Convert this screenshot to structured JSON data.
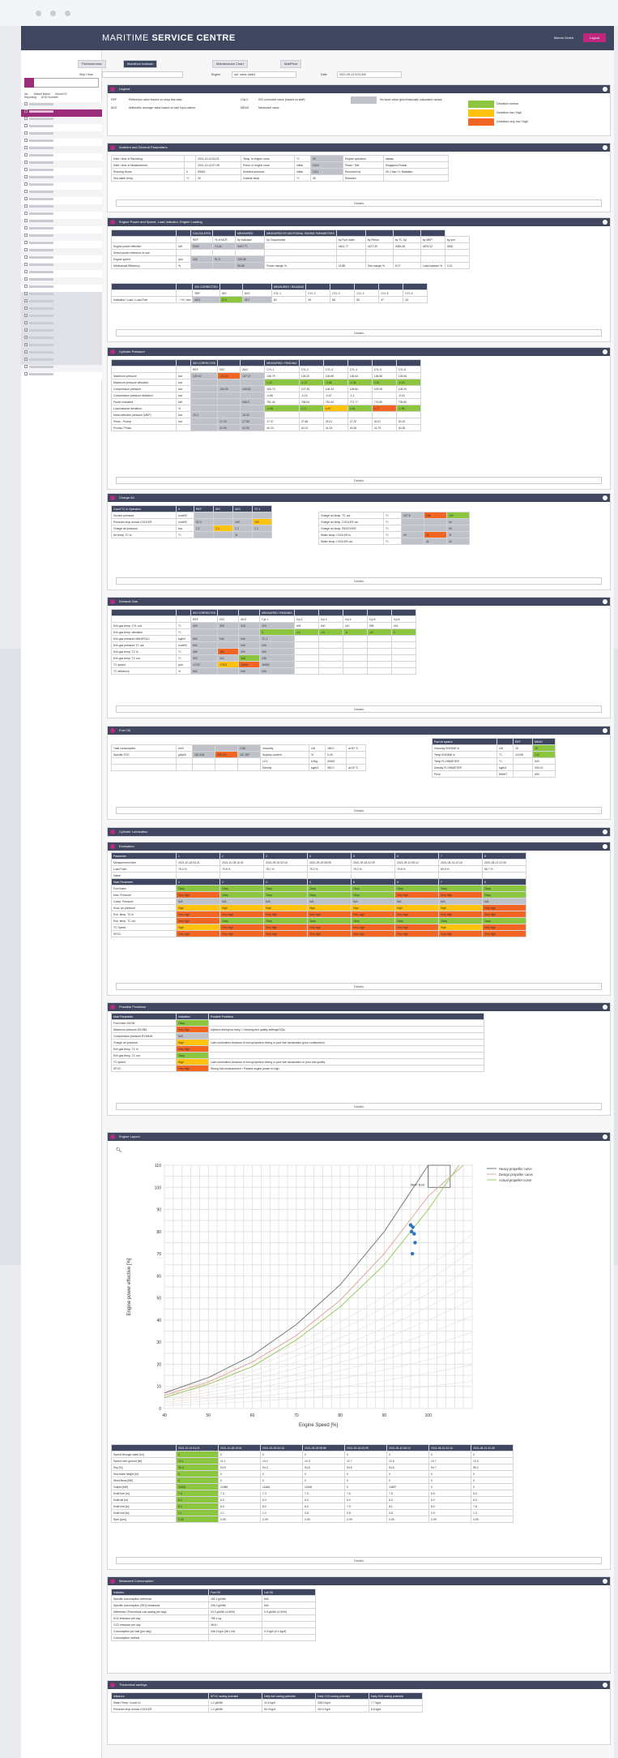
{
  "app": {
    "brand_light": "MARITIME ",
    "brand_bold": "SERVICE CENTRE",
    "user": "Marvin Gmbh",
    "logout": "Logout"
  },
  "sidebar": {
    "header": [
      "No.",
      "Vessel Name",
      "Vessel ID",
      "Reporting",
      "AHD Number"
    ],
    "item_count": 38
  },
  "tabs": [
    {
      "label": "Fleetoverview",
      "active": false
    },
    {
      "label": "Maruthon Inabuan",
      "active": true
    },
    {
      "label": "Maintenance Chart",
      "active": false
    },
    {
      "label": "MailPrice",
      "active": false
    }
  ],
  "filters": {
    "ship_label": "Ship / time",
    "engine_label": "Engine",
    "engine_value": "opt. value (date)",
    "date_label": "Date",
    "date_value": "2021-09-13 9:01 AM"
  },
  "legend": {
    "title": "Legend",
    "items": [
      [
        "REF",
        "Reference value based on shop test data"
      ],
      [
        "CALC",
        "ISO corrected value (based on shift)"
      ],
      [
        "AVG",
        "Arithmetic average value based on last input values"
      ],
      [
        "MEAS",
        "Measured value"
      ]
    ],
    "colors": [
      [
        "No input value given/manually calculated values",
        "#bfc2c8"
      ],
      [
        "Deviation normal",
        "#8cc63f"
      ],
      [
        "Deviation low / high",
        "#ffc20e"
      ],
      [
        "Deviation very low / high",
        "#f26522"
      ]
    ]
  },
  "sections": {
    "ambient": "Ambient and General Parameters",
    "power": "Engine Power and Speed, Load Indicator, Engine Loading",
    "cylinder": "Cylinder Pressure",
    "charge": "Charge Air",
    "exhaust": "Exhaust Gas",
    "fuel": "Fuel Oil",
    "lube": "Cylinder Lubrication",
    "evaluation": "Evaluation",
    "problems": "Possible Problems",
    "layout": "Engine Layout",
    "consumption": "Measured Consumption",
    "savings": "Theoretical savings"
  },
  "details_label": "Details",
  "ambient_rows": [
    [
      "Date / time of Reporting",
      "",
      "2021-10-13 04:21",
      "Temp. in engine room",
      "°C",
      "40",
      "Engine operation",
      "steady"
    ],
    [
      "Date / time of Measurement",
      "",
      "2021-10-13 07:45",
      "Press. in engine room",
      "mBar",
      "1016",
      "Place / Title",
      "Singapore Roads"
    ],
    [
      "Running Hours",
      "h",
      "59442",
      "Ambient pressure",
      "mBar",
      "1011",
      "Recorded by",
      "ZK Chan, H. Rattatten"
    ],
    [
      "Sea water temp.",
      "°C",
      "30",
      "Outside temp.",
      "°C",
      "30",
      "Remarks",
      ""
    ]
  ],
  "power_header": [
    "",
    "",
    "CALCULATED",
    "",
    "MEASURED",
    "MEASURED BY ADDITIONAL ENGINE PARAMETERS",
    "",
    "",
    "",
    ""
  ],
  "power_sub": [
    "",
    "",
    "REF",
    "% of MCR",
    "by Indicator",
    "by Torquemeter",
    "by Fuel Index",
    "by Fltexa",
    "by TC Sp",
    "by MEP",
    "by rpm"
  ],
  "power_rows": [
    [
      "Engine power effective",
      "kW",
      "9426",
      "74.44",
      "4497.77",
      "-",
      "4451.77",
      "4137.39",
      "4055.38",
      "4875.02",
      "3530"
    ],
    [
      "Select power reference in use",
      "",
      "",
      "",
      "",
      "",
      "",
      "",
      "",
      "",
      ""
    ],
    [
      "Engine speed",
      "rpm",
      "305",
      "91.5",
      "105.38",
      "",
      "",
      "",
      "",
      "",
      ""
    ],
    [
      "Mechanical Efficiency",
      "%",
      "",
      "",
      "96.88",
      "Power margin %",
      "15.85",
      "Sea margin %",
      "5.07",
      "Load balance %",
      "0.31"
    ]
  ],
  "power_cyl_header": [
    "",
    "",
    "ISO CORRECTED",
    "",
    "",
    "MEASURED / READING",
    "",
    "",
    "",
    "",
    ""
  ],
  "power_cyl_sub": [
    "",
    "",
    "REF",
    "ISO",
    "AVG",
    "CYL 1",
    "CYL 2",
    "CYL 3",
    "CYL 4",
    "CYL 5",
    "CYL 6"
  ],
  "power_cyl_rows": [
    [
      "Indicated / Load / Load Fuel",
      "- / % / mm",
      "68.6",
      "52.5",
      "48.7",
      "60",
      "49",
      "56",
      "50",
      "47",
      "43"
    ]
  ],
  "cyl_sub": [
    "",
    "",
    "REF",
    "ISO",
    "AVG",
    "CYL 1",
    "CYL 2",
    "CYL 3",
    "CYL 4",
    "CYL 5",
    "CYL 6"
  ],
  "cyl_rows": [
    [
      "Maximum pressure",
      "bar",
      "130.00",
      "141.00",
      "137.47",
      "136.79",
      "135.20",
      "135.69",
      "136.64",
      "136.56",
      "135.56"
    ],
    [
      "Maximum pressure deviation",
      "bar",
      "",
      "",
      "",
      "0.32",
      "-2.27",
      "-0.88",
      "-0.36",
      "0.91",
      "-0.15"
    ],
    [
      "Compression pressure",
      "bar",
      "",
      "106.90",
      "106.82",
      "106.73",
      "107.35",
      "106.43",
      "105.84",
      "105.95",
      "106.20"
    ],
    [
      "Compression pressure deviation",
      "bar",
      "",
      "",
      "",
      "-0.86",
      "-0.13",
      "-0.67",
      "-1.1",
      "",
      "-0.15"
    ],
    [
      "Power indicated",
      "kW",
      "",
      "",
      "946.9",
      "751.40",
      "784.54",
      "781.63",
      "771.77",
      "776.80",
      "735.80"
    ],
    [
      "Load balance deviation",
      "%",
      "",
      "",
      "",
      "-1.98",
      "4.71",
      "6.40",
      "3.46",
      "3.77",
      "-1.86"
    ],
    [
      "Mean effective pressure (MEP)",
      "bar",
      "19.2",
      "",
      "15.42",
      "",
      "",
      "",
      "",
      "",
      ""
    ],
    [
      "Pmax - Pcomp",
      "bar",
      "",
      "27.20",
      "27.83",
      "27.37",
      "27.86",
      "29.21",
      "27.32",
      "30.67",
      "30.20"
    ],
    [
      "Pcomp / Pmax",
      "",
      "",
      "41.90",
      "41.93",
      "40.23",
      "40.31",
      "41.34",
      "40.36",
      "41.79",
      "40.36"
    ]
  ],
  "charge_sub": [
    "",
    "",
    "REF",
    "ISO",
    "AVG",
    "TC 1"
  ],
  "charge_rows": [
    [
      "Count TC in Operation",
      "#",
      "REF",
      "ISO",
      "AVG",
      "TC 1"
    ],
    [
      "Suction pressure",
      "mmWC",
      "",
      "",
      "",
      ""
    ],
    [
      "Pressure drop across COOLER",
      "mmWC",
      "92.0",
      "",
      "165",
      "150"
    ],
    [
      "Charge air pressure",
      "bar",
      "2.1",
      "2.2",
      "2.2",
      "2.2"
    ],
    [
      "Air temp. TC in",
      "°C",
      "",
      "",
      "31",
      ""
    ]
  ],
  "charge_right": [
    [
      "Charge air temp. TC out",
      "°C",
      "207.8",
      "186",
      "190"
    ],
    [
      "Charge air temp. COOLER out",
      "°C",
      "",
      "",
      "44"
    ],
    [
      "Charge air temp. RECEIVER",
      "°C",
      "",
      "",
      "45"
    ],
    [
      "Water temp. COOLER in",
      "°C",
      "30",
      "31",
      "31"
    ],
    [
      "Water temp. COOLER out",
      "°C",
      "",
      "41",
      "42"
    ]
  ],
  "exh_sub": [
    "",
    "",
    "REF",
    "ISO",
    "AVG",
    "Cyl 1",
    "Cyl 2",
    "Cyl 3",
    "Cyl 4",
    "Cyl 5",
    "Cyl 6"
  ],
  "exh_rows": [
    [
      "Exh gas temp. CYL out",
      "°C",
      "400",
      "390",
      "415",
      "420",
      "405",
      "400",
      "410",
      "395",
      "415"
    ],
    [
      "Exh gas temp. deviation",
      "°C",
      "",
      "",
      "",
      "5",
      "-10",
      "-15",
      "-5",
      "-20",
      "0"
    ],
    [
      "Exh gas pressure MANIFOLD",
      "kg/m2",
      "N/A",
      "N/A",
      "N/A",
      "TC 1",
      "",
      "",
      "",
      "",
      ""
    ],
    [
      "Exh gas pressure TC out",
      "mmWC",
      "N/A",
      "",
      "N/A",
      "N/A",
      "",
      "",
      "",
      "",
      ""
    ],
    [
      "Exh gas temp. TC in",
      "°C",
      "480",
      "485",
      "490",
      "490",
      "",
      "",
      "",
      "",
      ""
    ],
    [
      "Exh gas temp. TC out",
      "°C",
      "320",
      "341",
      "338",
      "338",
      "",
      "",
      "",
      "",
      ""
    ],
    [
      "TC speed",
      "rpm",
      "17237",
      "17521",
      "18650",
      "18650",
      "",
      "",
      "",
      "",
      ""
    ],
    [
      "TC efficiency",
      "%",
      "N/A",
      "",
      "N/A",
      "N/A",
      "",
      "",
      "",
      "",
      ""
    ]
  ],
  "fuel_rows": [
    [
      "Total consumption",
      "t/m3",
      "",
      "",
      "1.66",
      "Viscosity",
      "cSt",
      "180.0",
      "at 50 °C"
    ],
    [
      "Specific FOC",
      "g/kWh",
      "182.108",
      "205.200",
      "197.287",
      "Sulphur content",
      "%",
      "0.49",
      ""
    ],
    [
      "",
      "",
      "",
      "",
      "",
      "LCV",
      "kJ/kg",
      "42620",
      ""
    ],
    [
      "",
      "",
      "",
      "",
      "",
      "Density",
      "kg/m3",
      "982.0",
      "at 15 °C"
    ]
  ],
  "fuel_right": [
    [
      "Viscosity ENGINE in",
      "cSt",
      "15",
      "15"
    ],
    [
      "Temp ENGINE in",
      "°C",
      "113.89",
      "140"
    ],
    [
      "Temp FLOWMETER",
      "°C",
      "",
      "540"
    ],
    [
      "Density FLOWMETER",
      "kg/m3",
      "",
      "920.01"
    ],
    [
      "Price",
      "$/MGT",
      "",
      "690"
    ]
  ],
  "eval_header": [
    "Parameter",
    "1",
    "2",
    "3",
    "4",
    "5",
    "6",
    "7",
    "8"
  ],
  "eval_rows": [
    [
      "Measurement time",
      "2021-10-18 04:21",
      "2021-10-08 10:01",
      "2021-09-30 02:16",
      "2021-09-25 08:55",
      "2021-09-18 22:09",
      "2021-09-10 06:12",
      "2021-08-31 22:16",
      "2021-08-21 22:45"
    ],
    [
      "Load Point",
      "75.4 %",
      "70.8 %",
      "78.1 %",
      "75.2 %",
      "75.2 %",
      "75.8 %",
      "69.9 %",
      "56.7 %"
    ],
    [
      "Name",
      "",
      "",
      "",
      "",
      "",
      "",
      "",
      ""
    ]
  ],
  "eval_status_header": [
    "Main Parameter",
    "1",
    "2",
    "3",
    "4",
    "5",
    "6",
    "7",
    "8"
  ],
  "eval_status": [
    [
      "Fuel Index",
      "Okay",
      "Okay",
      "Okay",
      "Okay",
      "Okay",
      "Okay",
      "Okay",
      "Okay"
    ],
    [
      "Max. Pressure",
      "Very high",
      "Okay",
      "Okay",
      "Okay",
      "Okay",
      "Very high",
      "Very high",
      "Okay"
    ],
    [
      "Comp. Pressure",
      "N/A",
      "N/A",
      "N/A",
      "N/A",
      "N/A",
      "N/A",
      "N/A",
      "N/A"
    ],
    [
      "Scav. air pressure",
      "High",
      "High",
      "High",
      "High",
      "High",
      "High",
      "High",
      "Very high"
    ],
    [
      "Exh. temp. TC in",
      "Very high",
      "Very high",
      "Very high",
      "Very high",
      "Very high",
      "Very high",
      "Very high",
      "Very high"
    ],
    [
      "Exh. temp. TC out",
      "Very high",
      "Okay",
      "Okay",
      "Okay",
      "Okay",
      "Okay",
      "Okay",
      "Okay"
    ],
    [
      "TC Speed",
      "High",
      "Very high",
      "Very high",
      "Very high",
      "Very high",
      "Very high",
      "High",
      "Very high"
    ],
    [
      "SFOC",
      "Very high",
      "Very high",
      "Very high",
      "Very high",
      "Very high",
      "Very high",
      "Very high",
      "Very high"
    ]
  ],
  "problems_header": [
    "Main Parameter",
    "Indication",
    "Possible Problems"
  ],
  "problems_rows": [
    [
      "Fuel Index DIGIN",
      "Okay",
      ""
    ],
    [
      "Maximum pressure DIGIN5",
      "Very high",
      "Injection timing too early / Checking fuel quality settings/VQIs"
    ],
    [
      "Compression pressure BYMAIN",
      "N/A",
      ""
    ],
    [
      "Charge air pressure",
      "High",
      "Late combustion because of wrong injection timing or poor fuel atomization (poor combustion)"
    ],
    [
      "Exh gas temp. TC in",
      "Very high",
      ""
    ],
    [
      "Exh gas temp. TC out",
      "Okay",
      ""
    ],
    [
      "TC speed",
      "High",
      "Late combustion because of wrong injection timing or poor fuel atomization or poor fuel quality"
    ],
    [
      "SFOC",
      "Very high",
      "Wrong fuel measurement / Packed engine power to high"
    ]
  ],
  "chart_data": {
    "type": "line",
    "title": "",
    "xlabel": "Engine Speed [%]",
    "ylabel": "Engine power effective [%]",
    "xlim": [
      40,
      110
    ],
    "ylim": [
      0,
      110
    ],
    "xticks": [
      40,
      50,
      60,
      70,
      80,
      90,
      100
    ],
    "yticks": [
      0,
      10,
      20,
      30,
      40,
      50,
      60,
      70,
      80,
      90,
      100,
      110
    ],
    "grid": true,
    "legend": "top-right",
    "annotation": "MEP limit",
    "series": [
      {
        "name": "Heavy propeller curve",
        "color": "#7a7a7a",
        "x": [
          40,
          50,
          60,
          70,
          80,
          90,
          100,
          105
        ],
        "y": [
          7,
          14,
          24,
          38,
          56,
          80,
          110,
          110
        ]
      },
      {
        "name": "Design propeller curve",
        "color": "#e0a89a",
        "x": [
          40,
          50,
          60,
          70,
          80,
          90,
          100,
          108
        ],
        "y": [
          6,
          12,
          21,
          33,
          49,
          70,
          96,
          110
        ]
      },
      {
        "name": "Actual propeller curve",
        "color": "#9ccc65",
        "x": [
          40,
          50,
          60,
          70,
          80,
          90,
          100,
          107
        ],
        "y": [
          5,
          11,
          19,
          31,
          46,
          65,
          90,
          110
        ]
      },
      {
        "name": "Measurements",
        "color": "#2e73c6",
        "type": "scatter",
        "x": [
          96,
          96.5,
          96.2,
          96.8,
          97.0,
          96.4
        ],
        "y": [
          83,
          82,
          80,
          79,
          75,
          70
        ]
      }
    ]
  },
  "layout_table_header": [
    "",
    "2021-10-13 04:21",
    "2021-10-08 10:01",
    "2021-09-30 02:16",
    "2021-09-25 08:55",
    "2021-09-18 22:09",
    "2021-09-10 06:12",
    "2021-08-31 22:16",
    "2021-08-21 22:45"
  ],
  "layout_table": [
    [
      "Speed through water [kn]",
      "0",
      "0",
      "0",
      "0",
      "0",
      "0",
      "0",
      "0"
    ],
    [
      "Speed over ground [kn]",
      "12.1",
      "11.1",
      "14.4",
      "12.3",
      "12.7",
      "12.6",
      "14.7",
      "10.5"
    ],
    [
      "Slip [%]",
      "95.0",
      "94.9",
      "94.3",
      "94.6",
      "94.6",
      "94.6",
      "94.7",
      "95.2"
    ],
    [
      "Sea scale height [m]",
      "0",
      "0",
      "0",
      "0",
      "0",
      "0",
      "0",
      "0"
    ],
    [
      "Wind Beau [Bft]",
      "0",
      "0",
      "0",
      "0",
      "0",
      "0",
      "0",
      "0"
    ],
    [
      "Output [kW]",
      "11466",
      "11386",
      "11466",
      "11406",
      "0",
      "10897",
      "0",
      "0"
    ],
    [
      "Draft fore [m]",
      "7.4",
      "7.4",
      "7.3",
      "7.3",
      "7.6",
      "7.5",
      "6.5",
      "6.0"
    ],
    [
      "Draft aft [m]",
      "6.0",
      "6.0",
      "6.0",
      "6.0",
      "6.0",
      "6.0",
      "6.0",
      "6.0"
    ],
    [
      "Draft mid [m]",
      "8.0",
      "8.0",
      "8.0",
      "8.0",
      "7.9",
      "8.1",
      "8.0",
      "7.8"
    ],
    [
      "Draft mid [m]",
      "1.1",
      "1.1",
      "1.0",
      "0.8",
      "0.8",
      "0.8",
      "0.9",
      "1.0"
    ],
    [
      "Rpm [rpm]",
      "0.09",
      "0.09",
      "0.09",
      "0.09",
      "0.09",
      "0.09",
      "0.09",
      "0.09"
    ]
  ],
  "consumption_header": [
    "Indicator",
    "Fuel Oil",
    "Lub Oil"
  ],
  "consumption_rows": [
    [
      "Specific consumption reference",
      "182.1 g/kWh",
      "N/A"
    ],
    [
      "Specific consumption (ISO) measured",
      "205.2 g/kWh",
      "N/A"
    ],
    [
      "Difference (Theoretical cost saving per day)",
      "23.2 g/kWh (4.55%)",
      "0.0 g/kWh (0.00%)"
    ],
    [
      "SO2 emission per day",
      "755.1 kg",
      ""
    ],
    [
      "CO2 emission per day",
      "38.6 t",
      ""
    ],
    [
      "Consumption per fuel (per day)",
      "346.2 kg/h (38.1 t/d)",
      "0.0 kg/h (0.0 kg/d)"
    ],
    [
      "Consumption method",
      "",
      ""
    ]
  ],
  "savings_header": [
    "Influence",
    "SFOC saving potential",
    "Daily fuel saving potential",
    "Daily CO2 saving potential",
    "Daily SO2 saving potential"
  ],
  "savings_rows": [
    [
      "Water Temp. Cooler in",
      "1.2 g/kWh",
      "11.5 kg/d",
      "208.0 kg/d",
      "7.7 kg/d"
    ],
    [
      "Pressure drop across COOLER",
      "1.2 g/kWh",
      "50.0 kg/d",
      "110.0 kg/d",
      "6.6 kg/d"
    ]
  ]
}
